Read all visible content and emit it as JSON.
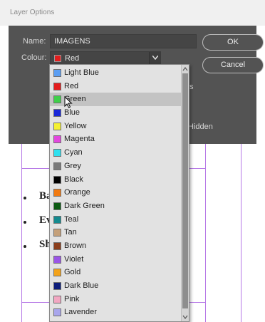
{
  "window": {
    "title": "Layer Options"
  },
  "form": {
    "name_label": "Name:",
    "name_value": "IMAGENS",
    "colour_label": "Colour:",
    "colour_value": "Red",
    "colour_swatch": "#e31d1d"
  },
  "buttons": {
    "ok": "OK",
    "cancel": "Cancel"
  },
  "options": {
    "partial_text": "s",
    "hidden_partial": "Hidden"
  },
  "document": {
    "bullets": [
      "Ba",
      "Ev",
      "Sh"
    ]
  },
  "dropdown": {
    "selected_index": 2,
    "items": [
      {
        "label": "Light Blue",
        "color": "#5b9ef2"
      },
      {
        "label": "Red",
        "color": "#e31d1d"
      },
      {
        "label": "Green",
        "color": "#3fcf4a"
      },
      {
        "label": "Blue",
        "color": "#1a28d8"
      },
      {
        "label": "Yellow",
        "color": "#f4f033"
      },
      {
        "label": "Magenta",
        "color": "#e248de"
      },
      {
        "label": "Cyan",
        "color": "#2fe0ee"
      },
      {
        "label": "Grey",
        "color": "#7a7a7a"
      },
      {
        "label": "Black",
        "color": "#000000"
      },
      {
        "label": "Orange",
        "color": "#f07a12"
      },
      {
        "label": "Dark Green",
        "color": "#0c5a12"
      },
      {
        "label": "Teal",
        "color": "#148a8f"
      },
      {
        "label": "Tan",
        "color": "#c4a07a"
      },
      {
        "label": "Brown",
        "color": "#8b3e1c"
      },
      {
        "label": "Violet",
        "color": "#9a55e6"
      },
      {
        "label": "Gold",
        "color": "#f2a21a"
      },
      {
        "label": "Dark Blue",
        "color": "#0c1c7a"
      },
      {
        "label": "Pink",
        "color": "#f2a7c2"
      },
      {
        "label": "Lavender",
        "color": "#a9a6ec"
      },
      {
        "label": "",
        "color": "#7a1e2e"
      }
    ]
  }
}
